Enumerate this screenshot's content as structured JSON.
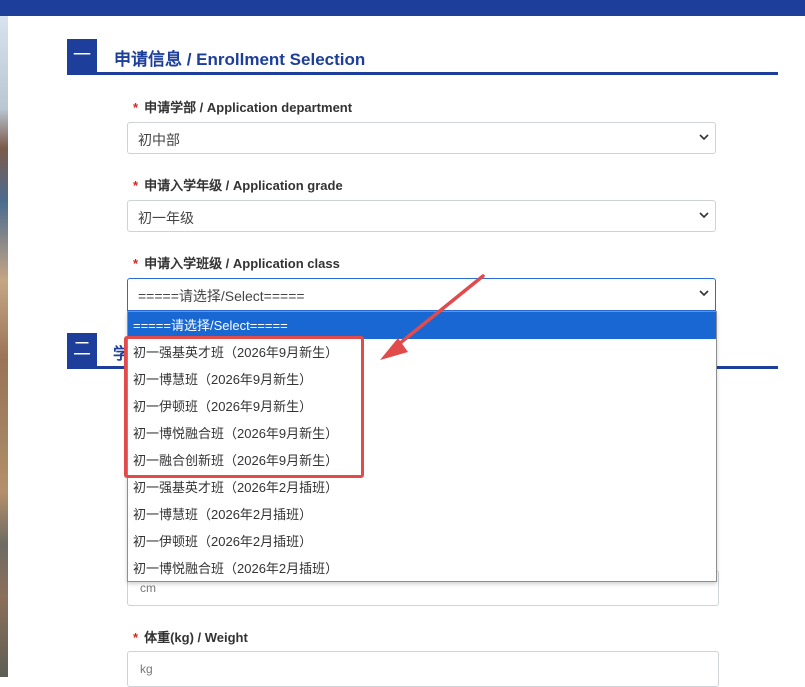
{
  "section1": {
    "number": "一",
    "title": "申请信息 / Enrollment Selection"
  },
  "section2": {
    "number": "二",
    "title_fragment": "学"
  },
  "fields": {
    "department": {
      "required_mark": "*",
      "label": "申请学部 / Application department",
      "value": "初中部"
    },
    "grade": {
      "required_mark": "*",
      "label": "申请入学年级 / Application grade",
      "value": "初一年级"
    },
    "class": {
      "required_mark": "*",
      "label": "申请入学班级 / Application class",
      "value": "=====请选择/Select====="
    },
    "height": {
      "placeholder": "cm"
    },
    "weight": {
      "required_mark": "*",
      "label": "体重(kg) / Weight",
      "placeholder": "kg"
    }
  },
  "dropdown": {
    "options": [
      "=====请选择/Select=====",
      "初一强基英才班（2026年9月新生）",
      "初一博慧班（2026年9月新生）",
      "初一伊顿班（2026年9月新生）",
      "初一博悦融合班（2026年9月新生）",
      "初一融合创新班（2026年9月新生）",
      "初一强基英才班（2026年2月插班）",
      "初一博慧班（2026年2月插班）",
      "初一伊顿班（2026年2月插班）",
      "初一博悦融合班（2026年2月插班）"
    ],
    "selected_index": 0
  },
  "colors": {
    "brand_blue": "#1d3f9b",
    "selected_option": "#1967d2",
    "annotation_red": "#e24b4b",
    "required_red": "#e02020"
  },
  "icons": {
    "select_arrow": "chevron-down-icon",
    "annotation": "arrow-pointer-icon"
  }
}
